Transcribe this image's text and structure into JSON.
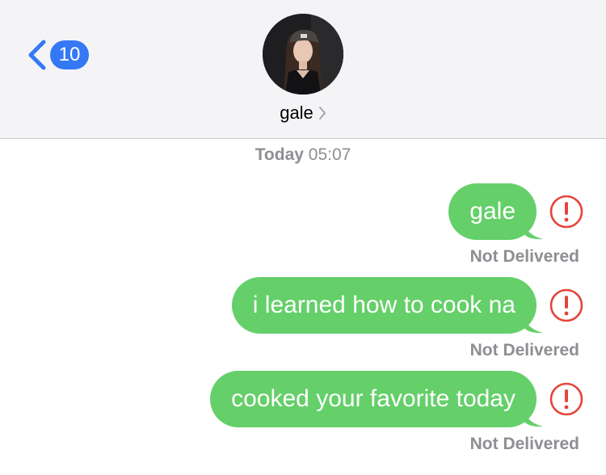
{
  "header": {
    "back_badge_count": "10",
    "contact_name": "gale"
  },
  "conversation": {
    "timestamp_day": "Today",
    "timestamp_time": "05:07",
    "messages": [
      {
        "text": "gale",
        "status": "Not Delivered"
      },
      {
        "text": "i learned how to cook na",
        "status": "Not Delivered"
      },
      {
        "text": "cooked your favorite today",
        "status": "Not Delivered"
      }
    ]
  },
  "colors": {
    "bubble": "#65cf6a",
    "badge": "#3478f6",
    "error": "#e5443a",
    "secondary_text": "#8e8e93"
  },
  "icons": {
    "back": "chevron-left-icon",
    "contact_chevron": "chevron-right-icon",
    "error": "exclamation-circle-icon"
  }
}
